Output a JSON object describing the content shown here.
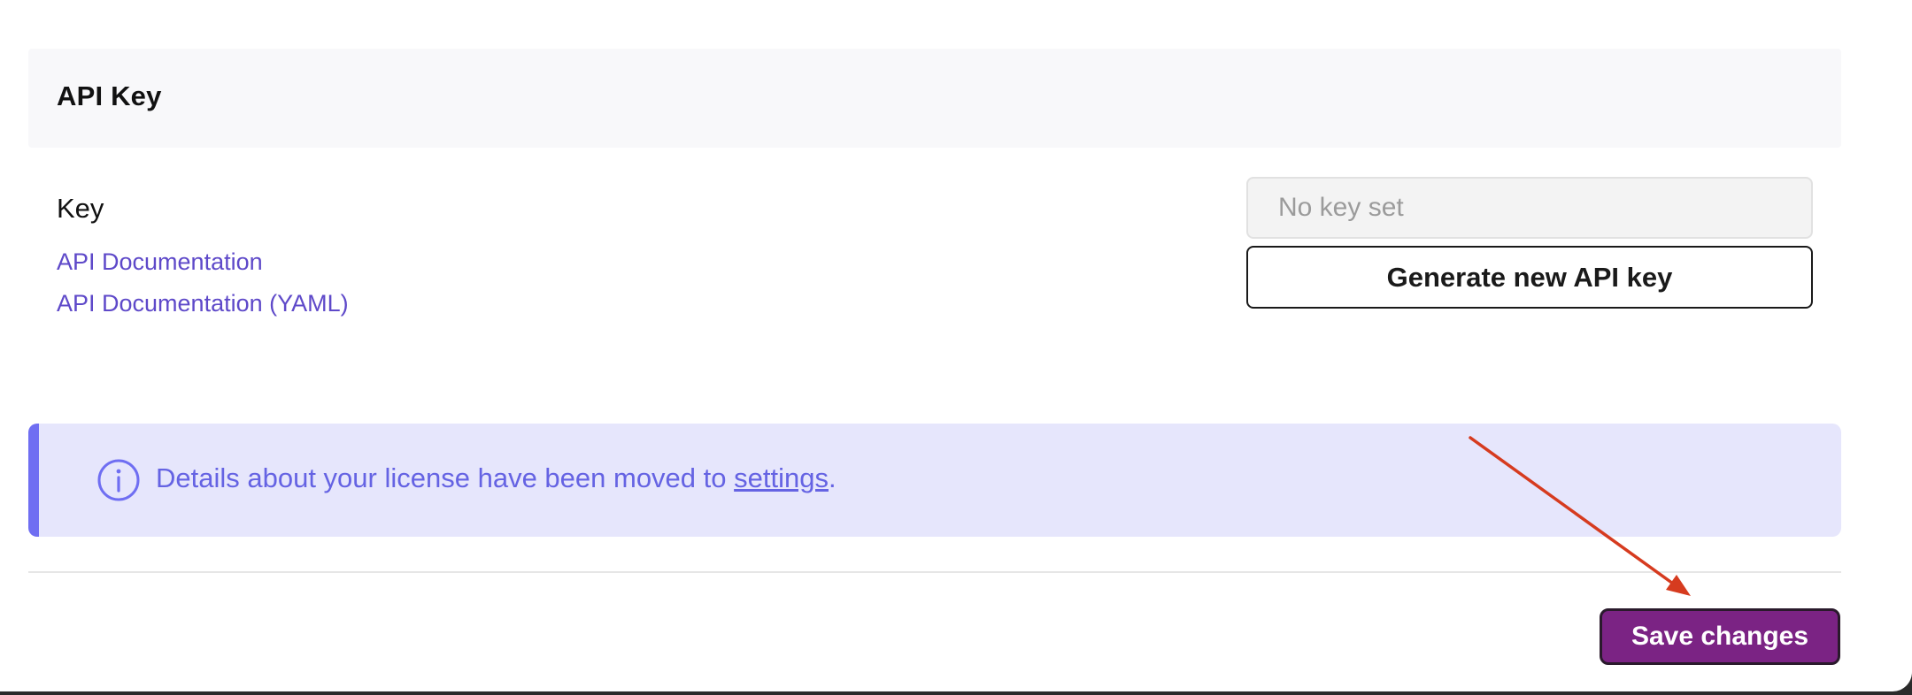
{
  "card": {
    "title": "API Key"
  },
  "key_section": {
    "label": "Key",
    "links": [
      {
        "label": "API Documentation"
      },
      {
        "label": "API Documentation (YAML)"
      }
    ],
    "input_placeholder": "No key set",
    "input_value": "",
    "generate_button_label": "Generate new API key"
  },
  "notice": {
    "icon": "info-circle-icon",
    "text_before": "Details about your license have been moved to ",
    "link_label": "settings",
    "text_after": "."
  },
  "footer": {
    "save_button_label": "Save changes"
  },
  "annotation": {
    "type": "arrow",
    "color": "#d63b1f"
  },
  "colors": {
    "accent": "#7b2384",
    "link": "#5e49c9",
    "notice_bg": "#e6e6fc",
    "notice_border": "#6f6ef2",
    "notice_text": "#6563e3"
  }
}
